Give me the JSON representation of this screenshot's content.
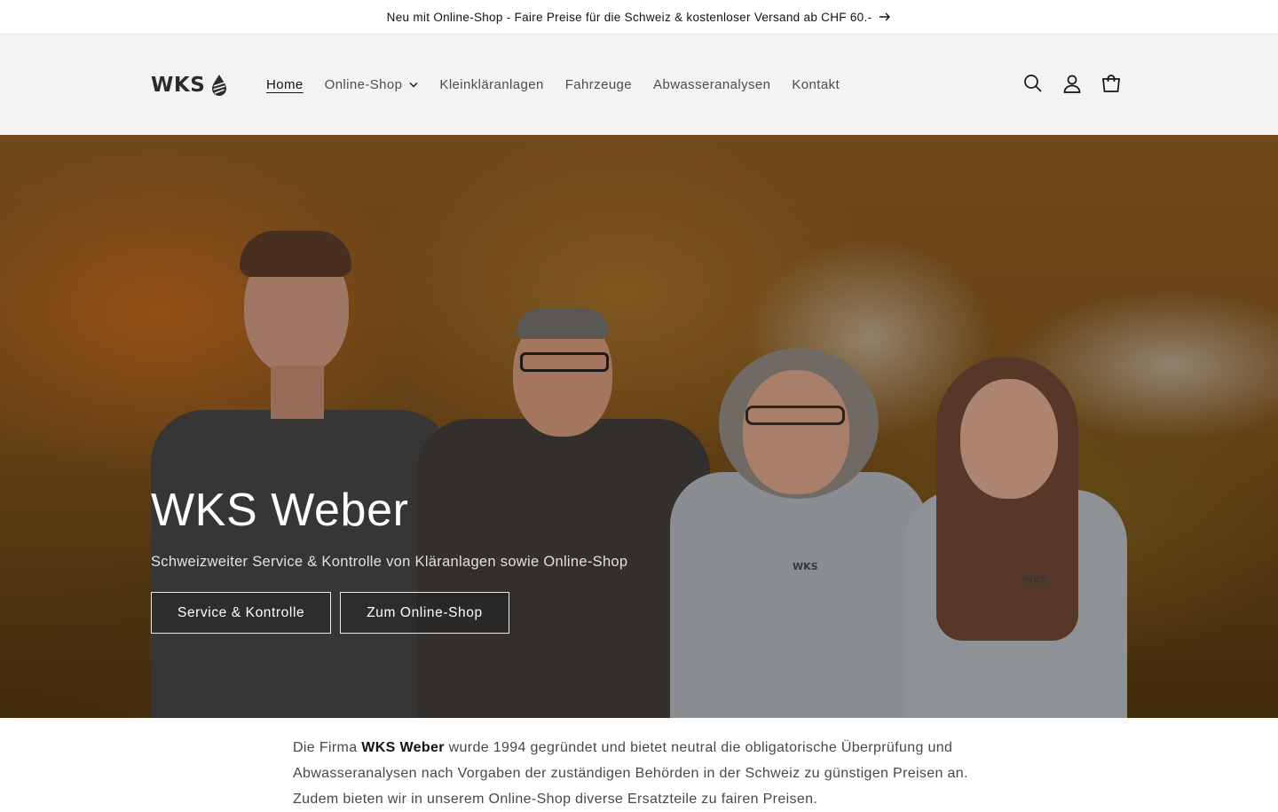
{
  "announcement": {
    "text": "Neu mit Online-Shop - Faire Preise für die Schweiz & kostenloser Versand ab CHF 60.-"
  },
  "header": {
    "logo_text": "WKS",
    "nav": [
      {
        "label": "Home",
        "active": true
      },
      {
        "label": "Online-Shop",
        "dropdown": true
      },
      {
        "label": "Kleinkläranlagen"
      },
      {
        "label": "Fahrzeuge"
      },
      {
        "label": "Abwasseranalysen"
      },
      {
        "label": "Kontakt"
      }
    ],
    "icons": [
      "search-icon",
      "account-icon",
      "cart-icon"
    ]
  },
  "hero": {
    "title": "WKS Weber",
    "subtitle": "Schweizweiter Service & Kontrolle von Kläranlagen sowie Online-Shop",
    "buttons": [
      {
        "label": "Service & Kontrolle"
      },
      {
        "label": "Zum Online-Shop"
      }
    ],
    "shirt_logo": "WKS"
  },
  "intro": {
    "prefix": "Die Firma ",
    "company": "WKS Weber",
    "rest": " wurde 1994 gegründet und bietet neutral die obligatorische Überprüfung und Abwasseranalysen nach Vorgaben der zuständigen Behörden in der Schweiz zu günstigen Preisen an.",
    "line3": "Zudem bieten wir in unserem Online-Shop diverse Ersatzteile zu fairen Preisen."
  },
  "colors": {
    "header_bg": "#f3f3f3",
    "text": "#121212"
  }
}
